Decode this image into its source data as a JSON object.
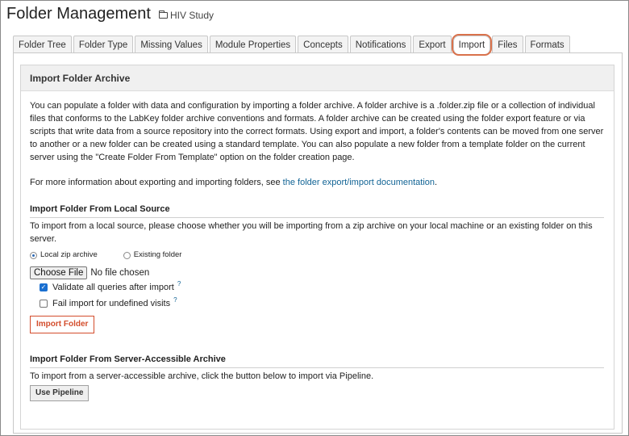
{
  "header": {
    "title": "Folder Management",
    "folder_name": "HIV Study"
  },
  "tabs": [
    {
      "label": "Folder Tree"
    },
    {
      "label": "Folder Type"
    },
    {
      "label": "Missing Values"
    },
    {
      "label": "Module Properties"
    },
    {
      "label": "Concepts"
    },
    {
      "label": "Notifications"
    },
    {
      "label": "Export"
    },
    {
      "label": "Import"
    },
    {
      "label": "Files"
    },
    {
      "label": "Formats"
    }
  ],
  "active_tab": "Import",
  "colors": {
    "highlight_ring": "#d9714b",
    "import_button": "#d34d2c",
    "link": "#126495"
  },
  "panel": {
    "heading": "Import Folder Archive",
    "intro": "You can populate a folder with data and configuration by importing a folder archive. A folder archive is a .folder.zip file or a collection of individual files that conforms to the LabKey folder archive conventions and formats. A folder archive can be created using the folder export feature or via scripts that write data from a source repository into the correct formats. Using export and import, a folder's contents can be moved from one server to another or a new folder can be created using a standard template. You can also populate a new folder from a template folder on the current server using the \"Create Folder From Template\" option on the folder creation page.",
    "more_info_prefix": "For more information about exporting and importing folders, see ",
    "more_info_link": "the folder export/import documentation",
    "more_info_suffix": "."
  },
  "local_source": {
    "title": "Import Folder From Local Source",
    "text": "To import from a local source, please choose whether you will be importing from a zip archive on your local machine or an existing folder on this server.",
    "radio_zip": "Local zip archive",
    "radio_existing": "Existing folder",
    "selected": "Local zip archive",
    "choose_file": "Choose File",
    "no_file": "No file chosen",
    "validate_label": "Validate all queries after import",
    "validate_checked": true,
    "fail_label": "Fail import for undefined visits",
    "fail_checked": false,
    "help_mark": "?",
    "import_button": "Import Folder"
  },
  "server_archive": {
    "title": "Import Folder From Server-Accessible Archive",
    "text": "To import from a server-accessible archive, click the button below to import via Pipeline.",
    "pipeline_button": "Use Pipeline"
  }
}
